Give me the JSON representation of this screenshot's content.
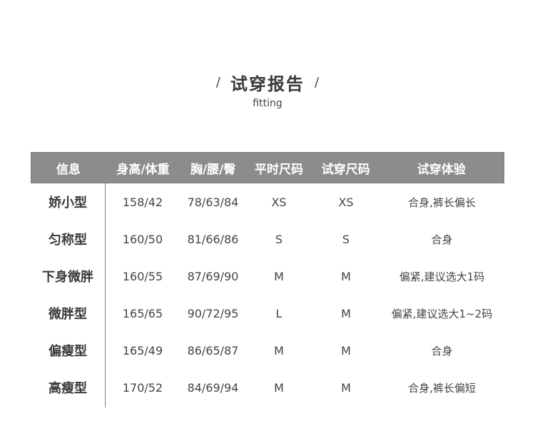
{
  "header": {
    "slash_left": "/",
    "title": "试穿报告",
    "slash_right": "/",
    "subtitle": "fitting"
  },
  "table": {
    "columns": [
      "信息",
      "身高/体重",
      "胸/腰/臀",
      "平时尺码",
      "试穿尺码",
      "试穿体验"
    ],
    "rows": [
      [
        "娇小型",
        "158/42",
        "78/63/84",
        "XS",
        "XS",
        "合身,裤长偏长"
      ],
      [
        "匀称型",
        "160/50",
        "81/66/86",
        "S",
        "S",
        "合身"
      ],
      [
        "下身微胖",
        "160/55",
        "87/69/90",
        "M",
        "M",
        "偏紧,建议选大1码"
      ],
      [
        "微胖型",
        "165/65",
        "90/72/95",
        "L",
        "M",
        "偏紧,建议选大1~2码"
      ],
      [
        "偏瘦型",
        "165/49",
        "86/65/87",
        "M",
        "M",
        "合身"
      ],
      [
        "高瘦型",
        "170/52",
        "84/69/94",
        "M",
        "M",
        "合身,裤长偏短"
      ]
    ]
  }
}
